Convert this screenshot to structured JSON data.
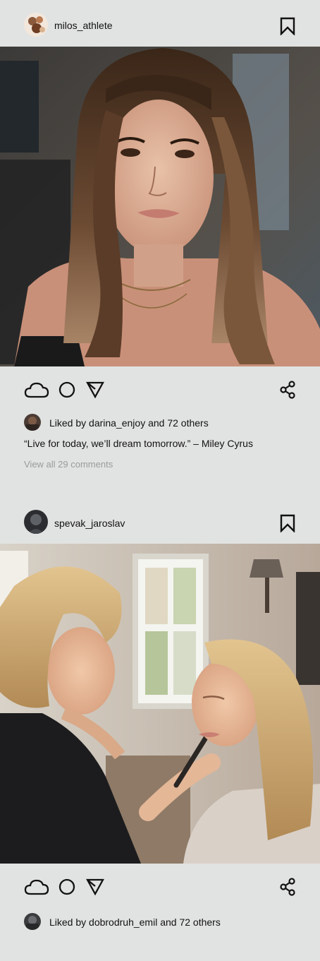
{
  "posts": [
    {
      "username": "milos_athlete",
      "liked_by": "Liked by darina_enjoy and 72 others",
      "caption": "“Live for today, we’ll dream tomorrow.” – Miley Cyrus",
      "comments_link": "View all 29 comments",
      "photo_icon": "portrait-photo",
      "action_icons": [
        "cloud-icon",
        "circle-icon",
        "send-icon",
        "share-icon"
      ],
      "bookmark_icon": "bookmark-icon"
    },
    {
      "username": "spevak_jaroslav",
      "liked_by": "Liked by dobrodruh_emil and 72 others",
      "photo_icon": "makeup-photo",
      "action_icons": [
        "cloud-icon",
        "circle-icon",
        "send-icon",
        "share-icon"
      ],
      "bookmark_icon": "bookmark-icon"
    }
  ],
  "colors": {
    "background": "#e1e3e2",
    "text": "#111111",
    "muted": "#9a9b9b"
  }
}
